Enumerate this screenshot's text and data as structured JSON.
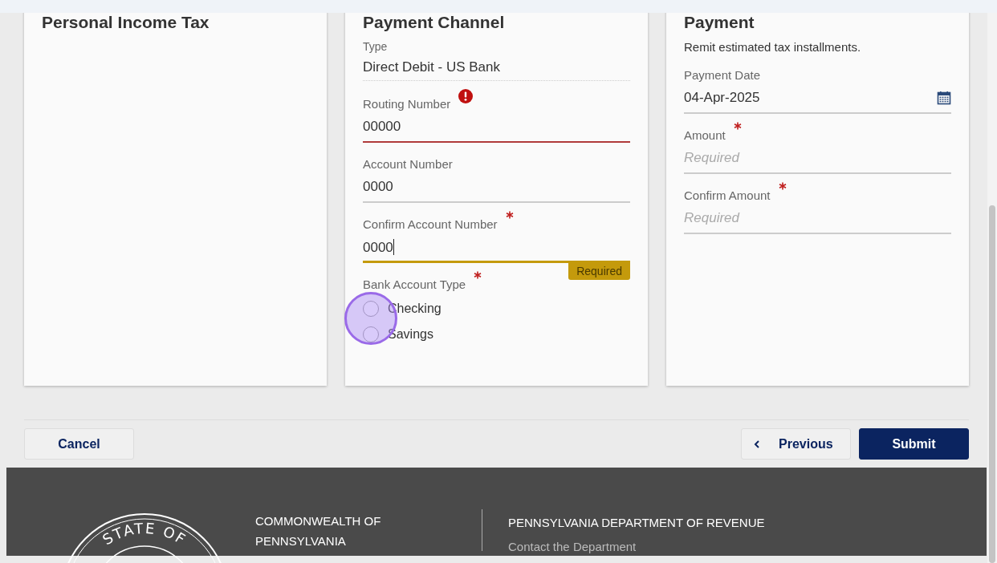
{
  "cards": [
    {
      "title": "Personal Income Tax"
    },
    {
      "title": "Payment Channel",
      "type_label": "Type",
      "type_value": "Direct Debit - US Bank",
      "fields": [
        {
          "label": "Routing Number",
          "value": "00000",
          "required": false,
          "error": true,
          "focused": false
        },
        {
          "label": "Account Number",
          "value": "0000",
          "required": false,
          "error": false,
          "focused": false
        },
        {
          "label": "Confirm Account Number",
          "value": "0000",
          "required": true,
          "error": false,
          "focused": true,
          "hint": "Required"
        }
      ],
      "radio_group": {
        "label": "Bank Account Type",
        "required": true,
        "options": [
          {
            "label": "Checking",
            "selected": false
          },
          {
            "label": "Savings",
            "selected": false
          }
        ]
      }
    },
    {
      "title": "Payment",
      "description": "Remit estimated tax installments.",
      "fields": [
        {
          "kind": "date",
          "label": "Payment Date",
          "value": "04-Apr-2025",
          "required": false
        },
        {
          "kind": "text",
          "label": "Amount",
          "placeholder": "Required",
          "required": true
        },
        {
          "kind": "text",
          "label": "Confirm Amount",
          "placeholder": "Required",
          "required": true
        }
      ]
    }
  ],
  "actions": {
    "cancel": "Cancel",
    "previous": "Previous",
    "submit": "Submit"
  },
  "footer": {
    "seal_text": "STATE OF",
    "org": "COMMONWEALTH OF PENNSYLVANIA",
    "department": "PENNSYLVANIA DEPARTMENT OF REVENUE",
    "link": "Contact the Department"
  }
}
